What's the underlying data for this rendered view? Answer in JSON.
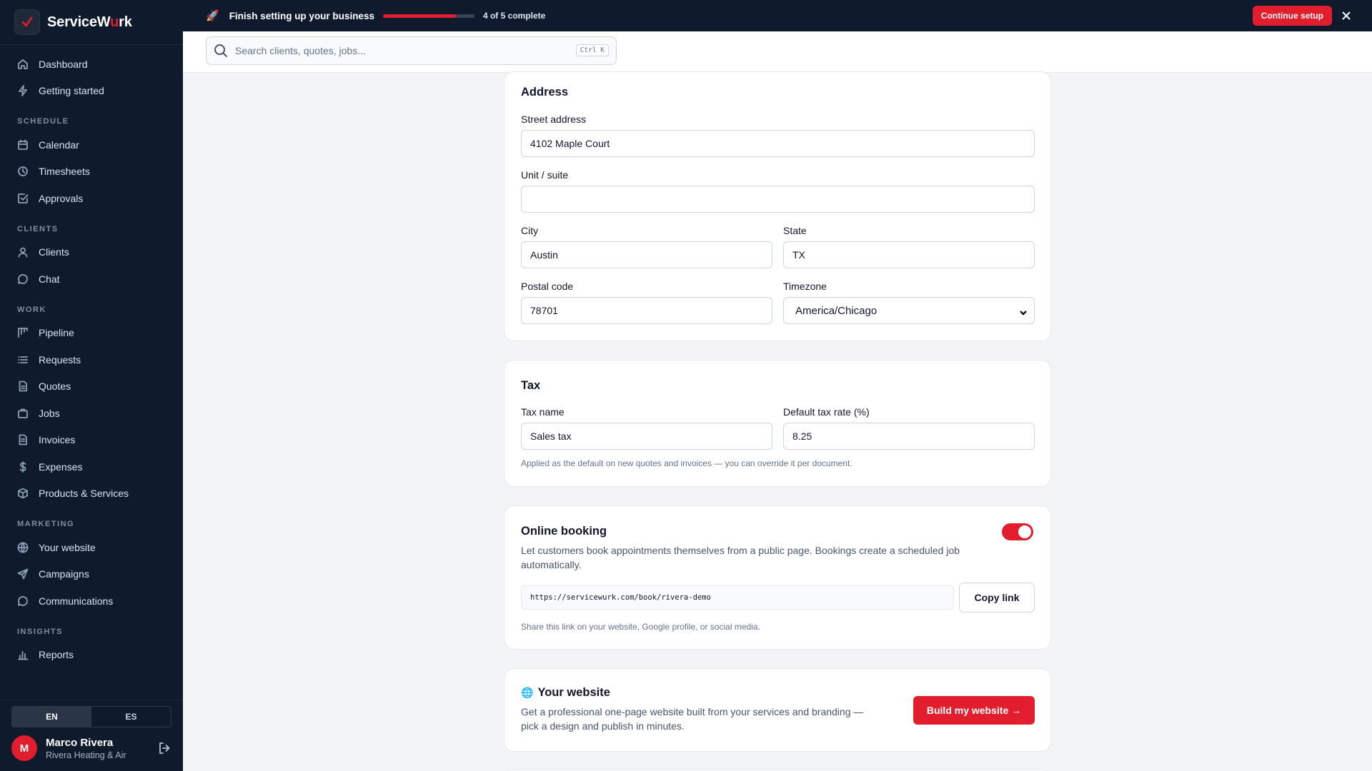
{
  "brand": {
    "name_prefix": "ServiceW",
    "name_accent": "u",
    "name_suffix": "rk"
  },
  "banner": {
    "title": "Finish setting up your business",
    "progress_fraction": 0.8,
    "progress_text": "4 of 5 complete",
    "continue_label": "Continue setup"
  },
  "search": {
    "placeholder": "Search clients, quotes, jobs...",
    "shortcut": "Ctrl K"
  },
  "sidebar": {
    "top_items": [
      {
        "label": "Dashboard",
        "icon": "home-icon"
      },
      {
        "label": "Getting started",
        "icon": "bolt-icon"
      }
    ],
    "sections": {
      "schedule": "SCHEDULE",
      "clients": "CLIENTS",
      "work": "WORK",
      "marketing": "MARKETING",
      "insights": "INSIGHTS"
    },
    "schedule_items": [
      "Calendar",
      "Timesheets",
      "Approvals"
    ],
    "clients_items": [
      "Clients",
      "Chat"
    ],
    "work_items": [
      "Pipeline",
      "Requests",
      "Quotes",
      "Jobs",
      "Invoices",
      "Expenses",
      "Products & Services"
    ],
    "marketing_items": [
      "Your website",
      "Campaigns",
      "Communications"
    ],
    "insights_items": [
      "Reports"
    ],
    "lang": {
      "en": "EN",
      "es": "ES",
      "active": "EN"
    },
    "user": {
      "initial": "M",
      "name": "Marco Rivera",
      "company": "Rivera Heating & Air"
    }
  },
  "address": {
    "title": "Address",
    "street_label": "Street address",
    "street_value": "4102 Maple Court",
    "unit_label": "Unit / suite",
    "unit_value": "",
    "city_label": "City",
    "city_value": "Austin",
    "state_label": "State",
    "state_value": "TX",
    "postal_label": "Postal code",
    "postal_value": "78701",
    "timezone_label": "Timezone",
    "timezone_value": "America/Chicago"
  },
  "tax": {
    "title": "Tax",
    "name_label": "Tax name",
    "name_value": "Sales tax",
    "rate_label": "Default tax rate (%)",
    "rate_value": "8.25",
    "hint": "Applied as the default on new quotes and invoices — you can override it per document."
  },
  "booking": {
    "title": "Online booking",
    "enabled": true,
    "description_line1": "Let customers book appointments themselves from a public page. Bookings create a scheduled job",
    "description_line2": "automatically.",
    "link": "https://servicewurk.com/book/rivera-demo",
    "copy_label": "Copy link",
    "hint": "Share this link on your website, Google profile, or social media."
  },
  "website": {
    "title": "Your website",
    "description_line1": "Get a professional one-page website built from your services and branding —",
    "description_line2": "pick a design and publish in minutes.",
    "button_label": "Build my website →"
  },
  "colors": {
    "accent": "#e11d2e",
    "sidebar_bg": "#0f1b2d",
    "page_bg": "#f3f4f6"
  }
}
